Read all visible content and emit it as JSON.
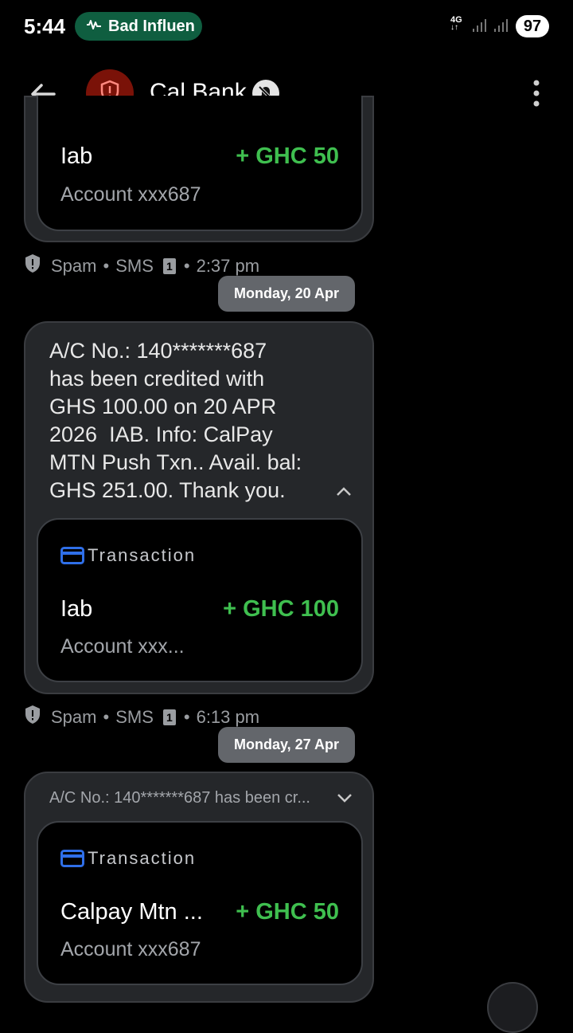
{
  "status_bar": {
    "time": "5:44",
    "media_label": "Bad Influen",
    "network": "4G",
    "battery": "97"
  },
  "app_bar": {
    "title": "Cal Bank"
  },
  "messages": [
    {
      "card": {
        "payee": "Iab",
        "amount": "+ GHC 50",
        "account": "Account xxx687"
      },
      "meta": {
        "spam": "Spam",
        "sms": "SMS",
        "sim": "1",
        "time": "2:37 pm"
      }
    },
    {
      "date_chip": "Monday, 20 Apr",
      "lines": [
        "A/C No.: 140*******687",
        "has been credited with",
        "GHS 100.00 on 20 APR",
        "2026  IAB. Info: CalPay",
        "MTN Push Txn.. Avail. bal:",
        "GHS 251.00. Thank you."
      ],
      "card": {
        "label": "Transaction",
        "payee": "Iab",
        "amount": "+ GHC 100",
        "account": "Account xxx..."
      },
      "meta": {
        "spam": "Spam",
        "sms": "SMS",
        "sim": "1",
        "time": "6:13 pm"
      }
    },
    {
      "date_chip": "Monday, 27 Apr",
      "preview": "A/C No.: 140*******687 has been cr...",
      "card": {
        "label": "Transaction",
        "payee": "Calpay Mtn ...",
        "amount": "+ GHC 50",
        "account": "Account xxx687"
      }
    }
  ],
  "colors": {
    "amount_green": "#3fbf4f",
    "card_icon_blue": "#2f6fe8",
    "avatar_red": "#7a1208"
  }
}
